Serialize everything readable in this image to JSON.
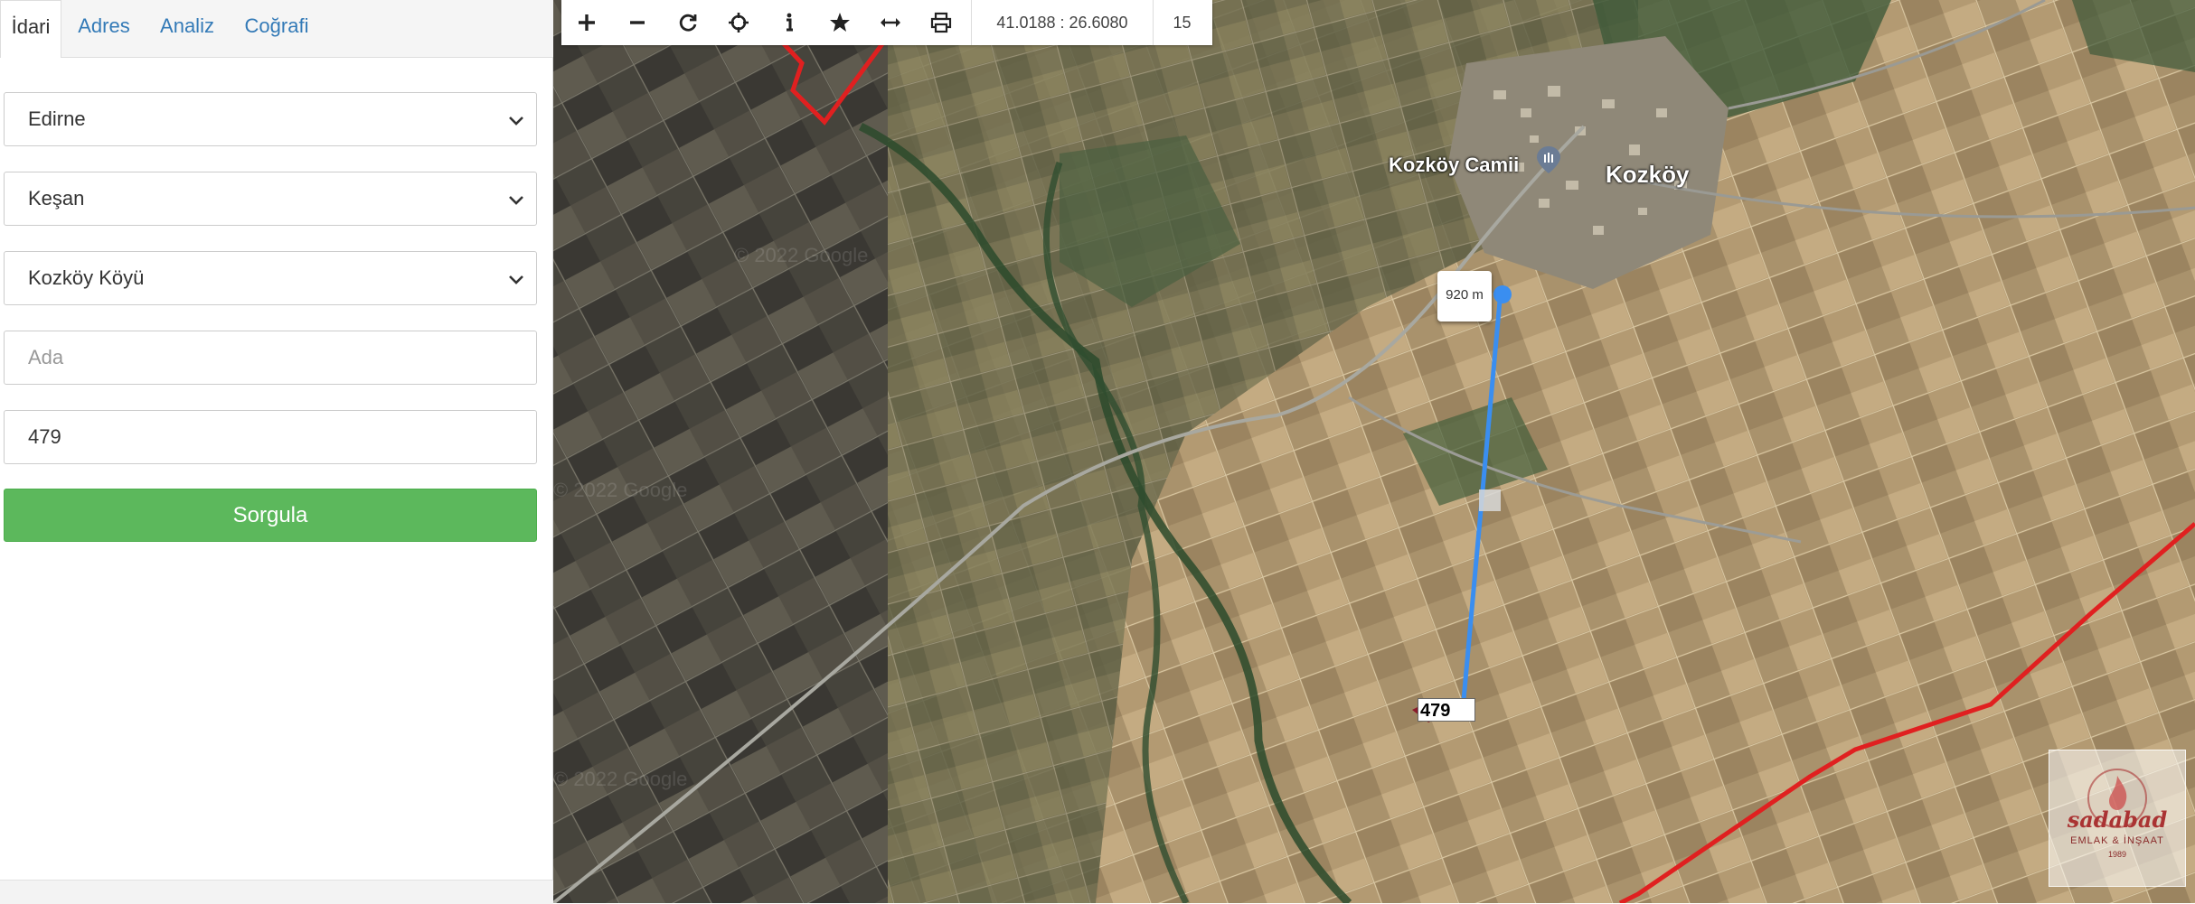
{
  "tabs": [
    {
      "label": "İdari"
    },
    {
      "label": "Adres"
    },
    {
      "label": "Analiz"
    },
    {
      "label": "Coğrafi"
    }
  ],
  "form": {
    "province": "Edirne",
    "district": "Keşan",
    "neighborhood": "Kozköy Köyü",
    "block_placeholder": "Ada",
    "block_value": "",
    "parcel_value": "479",
    "submit_label": "Sorgula"
  },
  "toolbar": {
    "coordinates": "41.0188 : 26.6080",
    "zoom_level": "15",
    "tools": [
      "zoom-in",
      "zoom-out",
      "refresh",
      "locate",
      "info",
      "favorite",
      "measure",
      "print"
    ]
  },
  "map": {
    "labels": {
      "mosque": "Kozköy Camii",
      "village": "Kozköy"
    },
    "measurement": "920 m",
    "parcel_number": "479",
    "watermark": {
      "name": "sadabad",
      "subtitle": "EMLAK & İNŞAAT",
      "year": "1989"
    }
  },
  "colors": {
    "primary_link": "#337ab7",
    "submit_button": "#5cb85c",
    "boundary_line": "#e02020",
    "measure_line": "#3a8ef0"
  }
}
